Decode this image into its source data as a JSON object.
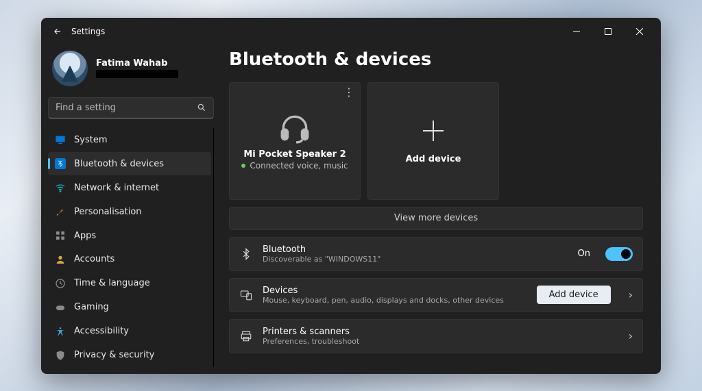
{
  "titlebar": {
    "title": "Settings"
  },
  "profile": {
    "name": "Fatima Wahab"
  },
  "search": {
    "placeholder": "Find a setting"
  },
  "nav": {
    "items": [
      {
        "label": "System"
      },
      {
        "label": "Bluetooth & devices"
      },
      {
        "label": "Network & internet"
      },
      {
        "label": "Personalisation"
      },
      {
        "label": "Apps"
      },
      {
        "label": "Accounts"
      },
      {
        "label": "Time & language"
      },
      {
        "label": "Gaming"
      },
      {
        "label": "Accessibility"
      },
      {
        "label": "Privacy & security"
      }
    ]
  },
  "page": {
    "heading": "Bluetooth & devices",
    "device_tile": {
      "name": "Mi Pocket Speaker 2",
      "status": "Connected voice, music"
    },
    "add_tile": {
      "label": "Add device"
    },
    "view_more": "View more devices",
    "bluetooth_row": {
      "title": "Bluetooth",
      "sub": "Discoverable as \"WINDOWS11\"",
      "state": "On"
    },
    "devices_row": {
      "title": "Devices",
      "sub": "Mouse, keyboard, pen, audio, displays and docks, other devices",
      "button": "Add device"
    },
    "printers_row": {
      "title": "Printers & scanners",
      "sub": "Preferences, troubleshoot"
    }
  }
}
